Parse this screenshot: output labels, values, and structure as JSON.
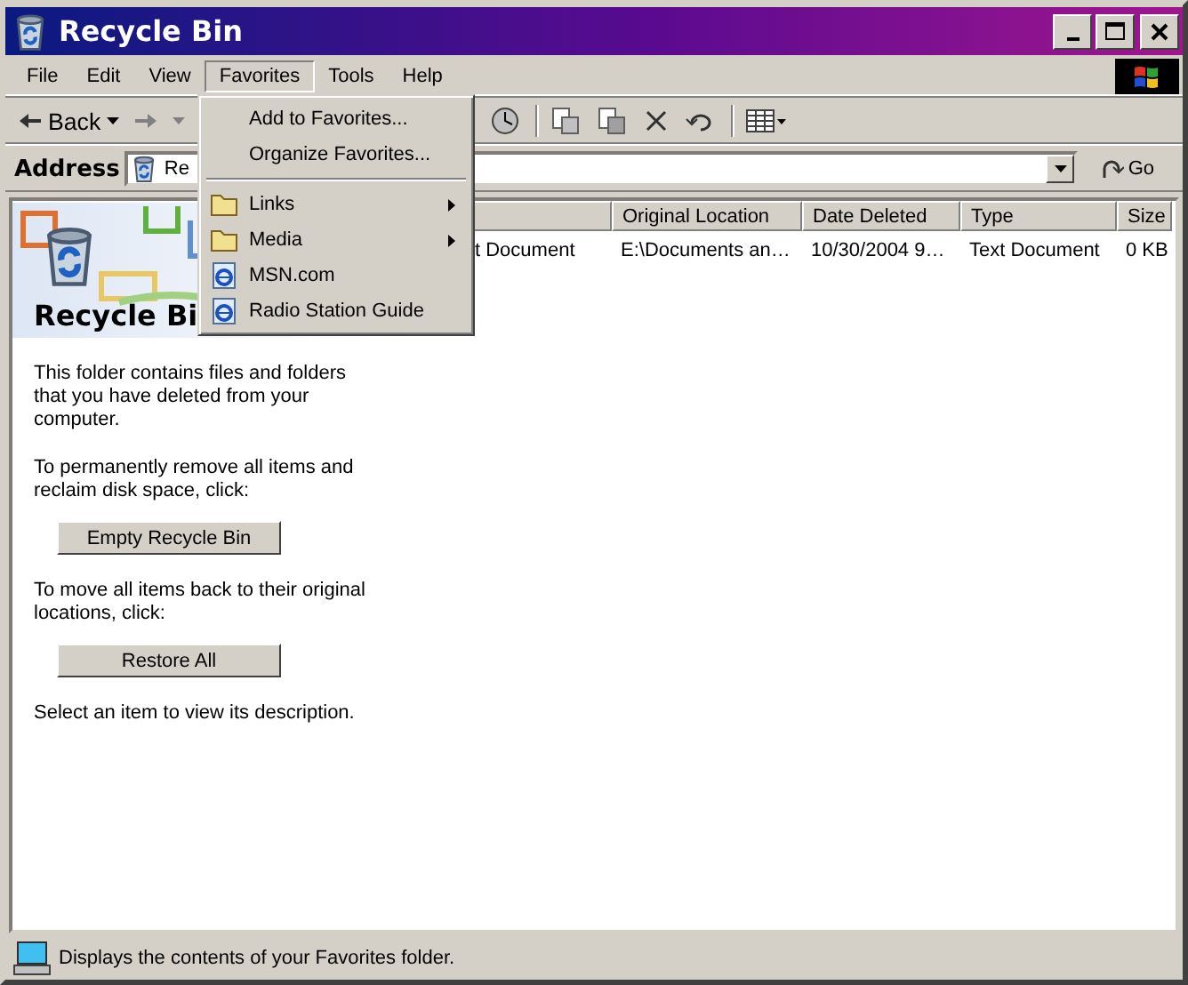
{
  "window": {
    "title": "Recycle Bin"
  },
  "menu_bar": [
    {
      "label": "File",
      "selected": false
    },
    {
      "label": "Edit",
      "selected": false
    },
    {
      "label": "View",
      "selected": false
    },
    {
      "label": "Favorites",
      "selected": true
    },
    {
      "label": "Tools",
      "selected": false
    },
    {
      "label": "Help",
      "selected": false
    }
  ],
  "toolbar": {
    "back": "Back"
  },
  "address_bar": {
    "label": "Address",
    "value": "Re",
    "go": "Go"
  },
  "info_pane": {
    "title": "Recycle Bi",
    "sections": [
      {
        "text": "This folder contains files and folders that you have deleted from your computer."
      },
      {
        "text": "To permanently remove all items and reclaim disk space, click:",
        "button": "Empty Recycle Bin"
      },
      {
        "text": "To move all items back to their original locations, click:",
        "button": "Restore All"
      },
      {
        "text": "Select an item to view its description."
      }
    ]
  },
  "file_list": {
    "columns": [
      {},
      {
        "label": "Original Location"
      },
      {
        "label": "Date Deleted"
      },
      {
        "label": "Type"
      },
      {
        "label": "Size"
      }
    ],
    "rows": [
      {
        "cells": [
          "t Document",
          "E:\\Documents an…",
          "10/30/2004 9…",
          "Text Document",
          "0 KB"
        ]
      }
    ]
  },
  "favorites_menu": [
    {
      "kind": "command",
      "label": "Add to Favorites..."
    },
    {
      "kind": "command",
      "label": "Organize Favorites..."
    },
    {
      "kind": "separator"
    },
    {
      "kind": "folder",
      "label": "Links"
    },
    {
      "kind": "folder",
      "label": "Media"
    },
    {
      "kind": "link",
      "label": "MSN.com"
    },
    {
      "kind": "link",
      "label": "Radio Station Guide"
    }
  ],
  "status_bar": {
    "text": "Displays the contents of your Favorites folder."
  }
}
